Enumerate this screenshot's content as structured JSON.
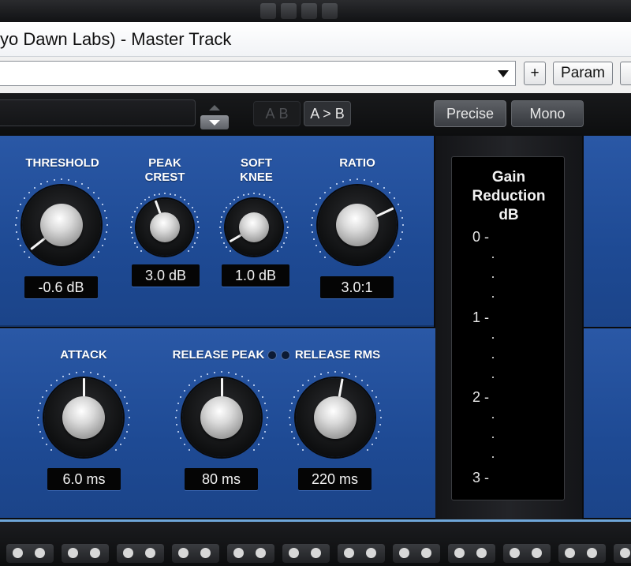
{
  "window": {
    "title": "yo Dawn Labs) - Master Track"
  },
  "fx_toolbar": {
    "preset_value": "",
    "add_label": "+",
    "param_label": "Param"
  },
  "plugin_header": {
    "preset_name": "",
    "ab_a_label": "A",
    "ab_b_label": "B",
    "ab_copy_label": "A > B",
    "precise_label": "Precise",
    "mono_label": "Mono"
  },
  "controls": {
    "threshold": {
      "label": "THRESHOLD",
      "value": "-0.6 dB"
    },
    "peak_crest": {
      "label_line1": "PEAK",
      "label_line2": "CREST",
      "value": "3.0 dB"
    },
    "soft_knee": {
      "label_line1": "SOFT",
      "label_line2": "KNEE",
      "value": "1.0 dB"
    },
    "ratio": {
      "label": "RATIO",
      "value": "3.0:1"
    },
    "attack": {
      "label": "ATTACK",
      "value": "6.0 ms"
    },
    "release_peak": {
      "label": "RELEASE PEAK",
      "value": "80 ms"
    },
    "release_rms": {
      "label": "RELEASE RMS",
      "value": "220 ms"
    }
  },
  "gain_reduction_meter": {
    "title_line1": "Gain",
    "title_line2": "Reduction",
    "title_line3": "dB",
    "ticks": [
      "0 -",
      "1 -",
      "2 -",
      "3 -"
    ]
  },
  "colors": {
    "panel_blue": "#2a58a6",
    "meter_bg": "#000000",
    "accent_line": "#6fa7d9"
  }
}
